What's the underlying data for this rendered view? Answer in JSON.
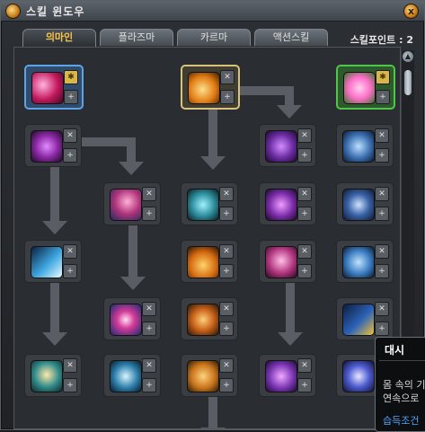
{
  "window": {
    "title": "스킬 윈도우",
    "close_label": "x"
  },
  "tabs": [
    {
      "label": "의마인",
      "active": true
    },
    {
      "label": "플라즈마",
      "active": false
    },
    {
      "label": "카르마",
      "active": false
    },
    {
      "label": "액션스킬",
      "active": false
    }
  ],
  "skill_points": "스킬포인트 : 2",
  "skills": [
    {
      "name": "skill-1-1",
      "icon": "pink-slash-icon",
      "color": "#c2185b"
    },
    {
      "name": "skill-1-2",
      "icon": "fire-hand-icon",
      "color": "#e07a12"
    },
    {
      "name": "skill-1-3",
      "icon": "pink-face-icon",
      "color": "#ff6fc8"
    },
    {
      "name": "skill-2-1",
      "icon": "purple-orb-icon",
      "color": "#8e2aa8"
    },
    {
      "name": "skill-2-2",
      "icon": "violet-swirl-icon",
      "color": "#6a2ba0"
    },
    {
      "name": "skill-2-3",
      "icon": "blue-aura-icon",
      "color": "#3c6fb0"
    },
    {
      "name": "skill-3-1",
      "icon": "pink-strike-icon",
      "color": "#b0347a"
    },
    {
      "name": "skill-3-2",
      "icon": "cyan-figure-icon",
      "color": "#2b8a98"
    },
    {
      "name": "skill-3-3",
      "icon": "purple-claw-icon",
      "color": "#7a2ca8"
    },
    {
      "name": "skill-3-4",
      "icon": "shield-icon",
      "color": "#3a62a6"
    },
    {
      "name": "skill-4-1",
      "icon": "ice-beam-icon",
      "color": "#3ea6e0"
    },
    {
      "name": "skill-4-2",
      "icon": "flame-rp-icon",
      "color": "#d56a10"
    },
    {
      "name": "skill-4-3",
      "icon": "rose-fist-icon",
      "color": "#b1357f"
    },
    {
      "name": "skill-4-4",
      "icon": "blue-runner-icon",
      "color": "#3a7cc0"
    },
    {
      "name": "skill-5-1",
      "icon": "pink-burst-icon",
      "color": "#d43c99"
    },
    {
      "name": "skill-5-2",
      "icon": "fire-dash-icon",
      "color": "#c8621a"
    },
    {
      "name": "skill-5-3",
      "icon": "dash-icon",
      "color": "#2c63b8"
    },
    {
      "name": "skill-6-1",
      "icon": "sage-icon",
      "color": "#2f8a8a"
    },
    {
      "name": "skill-6-2",
      "icon": "blue-flare-icon",
      "color": "#2a7ca8"
    },
    {
      "name": "skill-6-3",
      "icon": "orange-fist-icon",
      "color": "#c9741c"
    },
    {
      "name": "skill-6-4",
      "icon": "purple-storm-icon",
      "color": "#7b36b3"
    },
    {
      "name": "skill-6-5",
      "icon": "burst-aura-icon",
      "color": "#4e5cd0"
    }
  ],
  "tooltip": {
    "title": "대시",
    "desc_line1": "몸 속의 기",
    "desc_line2": "연속으로",
    "condition": "습득조건"
  }
}
